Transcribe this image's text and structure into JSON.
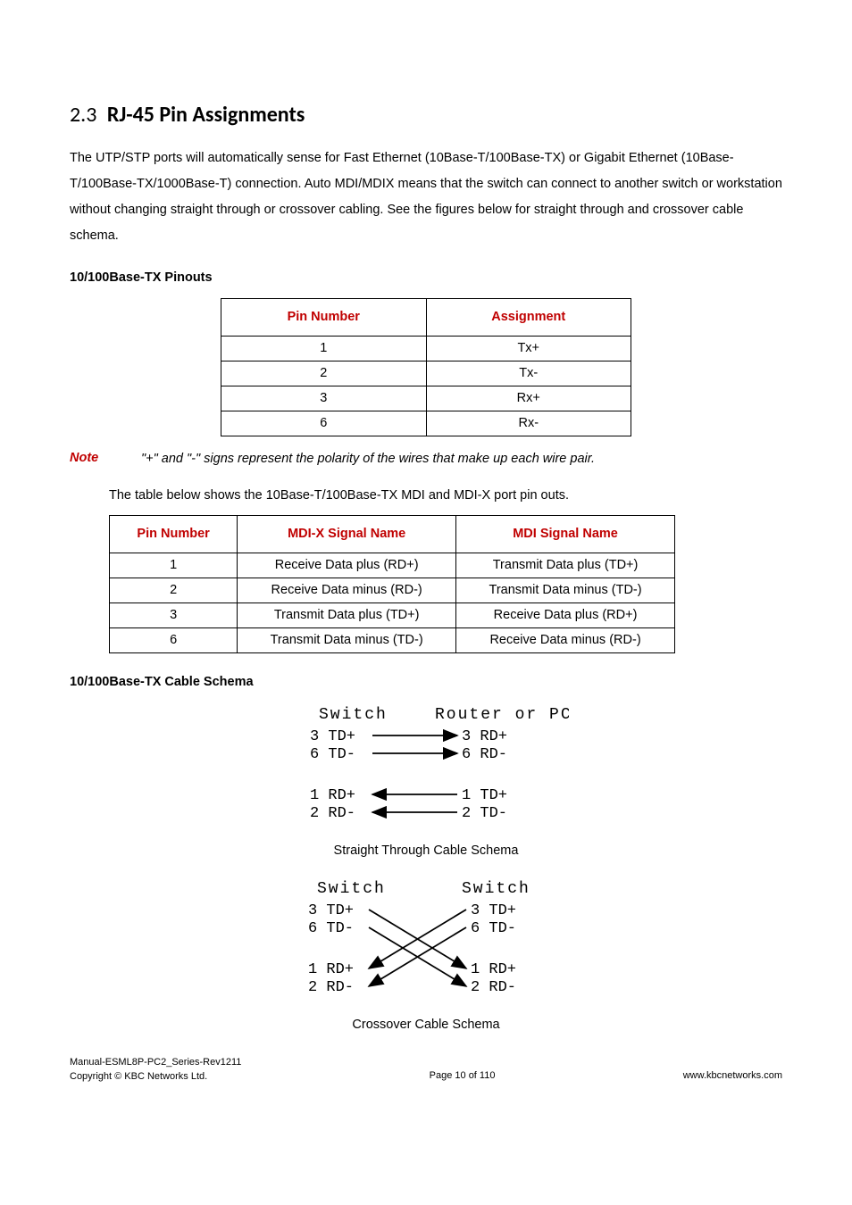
{
  "heading": {
    "number": "2.3",
    "title": "RJ-45 Pin Assignments"
  },
  "intro": "The UTP/STP ports will automatically sense for Fast Ethernet (10Base-T/100Base-TX) or Gigabit Ethernet (10Base-T/100Base-TX/1000Base-T) connection. Auto MDI/MDIX means that the switch can connect to another switch or workstation without changing straight through or crossover cabling. See the figures below for straight through and crossover cable schema.",
  "sub1": "10/100Base-TX Pinouts",
  "table1": {
    "headers": [
      "Pin Number",
      "Assignment"
    ],
    "rows": [
      [
        "1",
        "Tx+"
      ],
      [
        "2",
        "Tx-"
      ],
      [
        "3",
        "Rx+"
      ],
      [
        "6",
        "Rx-"
      ]
    ]
  },
  "note": {
    "label": "Note",
    "text": "\"+\" and \"-\" signs represent the polarity of the wires that make up each wire pair."
  },
  "mdi_intro": "The table below shows the 10Base-T/100Base-TX MDI and MDI-X port pin outs.",
  "table2": {
    "headers": [
      "Pin Number",
      "MDI-X Signal Name",
      "MDI Signal Name"
    ],
    "rows": [
      [
        "1",
        "Receive Data plus (RD+)",
        "Transmit Data plus (TD+)"
      ],
      [
        "2",
        "Receive Data minus (RD-)",
        "Transmit Data minus (TD-)"
      ],
      [
        "3",
        "Transmit Data plus (TD+)",
        "Receive Data plus (RD+)"
      ],
      [
        "6",
        "Transmit Data minus (TD-)",
        "Receive Data minus (RD-)"
      ]
    ]
  },
  "sub2": "10/100Base-TX Cable Schema",
  "diagram1": {
    "left_title": "Switch",
    "right_title": "Router or PC",
    "lines": [
      {
        "l": "3  TD+",
        "r": "3  RD+"
      },
      {
        "l": "6  TD-",
        "r": "6  RD-"
      },
      {
        "l": "1  RD+",
        "r": "1  TD+"
      },
      {
        "l": "2  RD-",
        "r": "2  TD-"
      }
    ],
    "caption": "Straight Through Cable Schema"
  },
  "diagram2": {
    "left_title": "Switch",
    "right_title": "Switch",
    "lines": [
      {
        "l": "3  TD+",
        "r": "3  TD+"
      },
      {
        "l": "6  TD-",
        "r": "6  TD-"
      },
      {
        "l": "1  RD+",
        "r": "1  RD+"
      },
      {
        "l": "2  RD-",
        "r": "2  RD-"
      }
    ],
    "caption": "Crossover Cable Schema"
  },
  "footer": {
    "line1": "Manual-ESML8P-PC2_Series-Rev1211",
    "line2": "Copyright © KBC Networks Ltd.",
    "page": "Page 10 of 110",
    "url": "www.kbcnetworks.com"
  }
}
